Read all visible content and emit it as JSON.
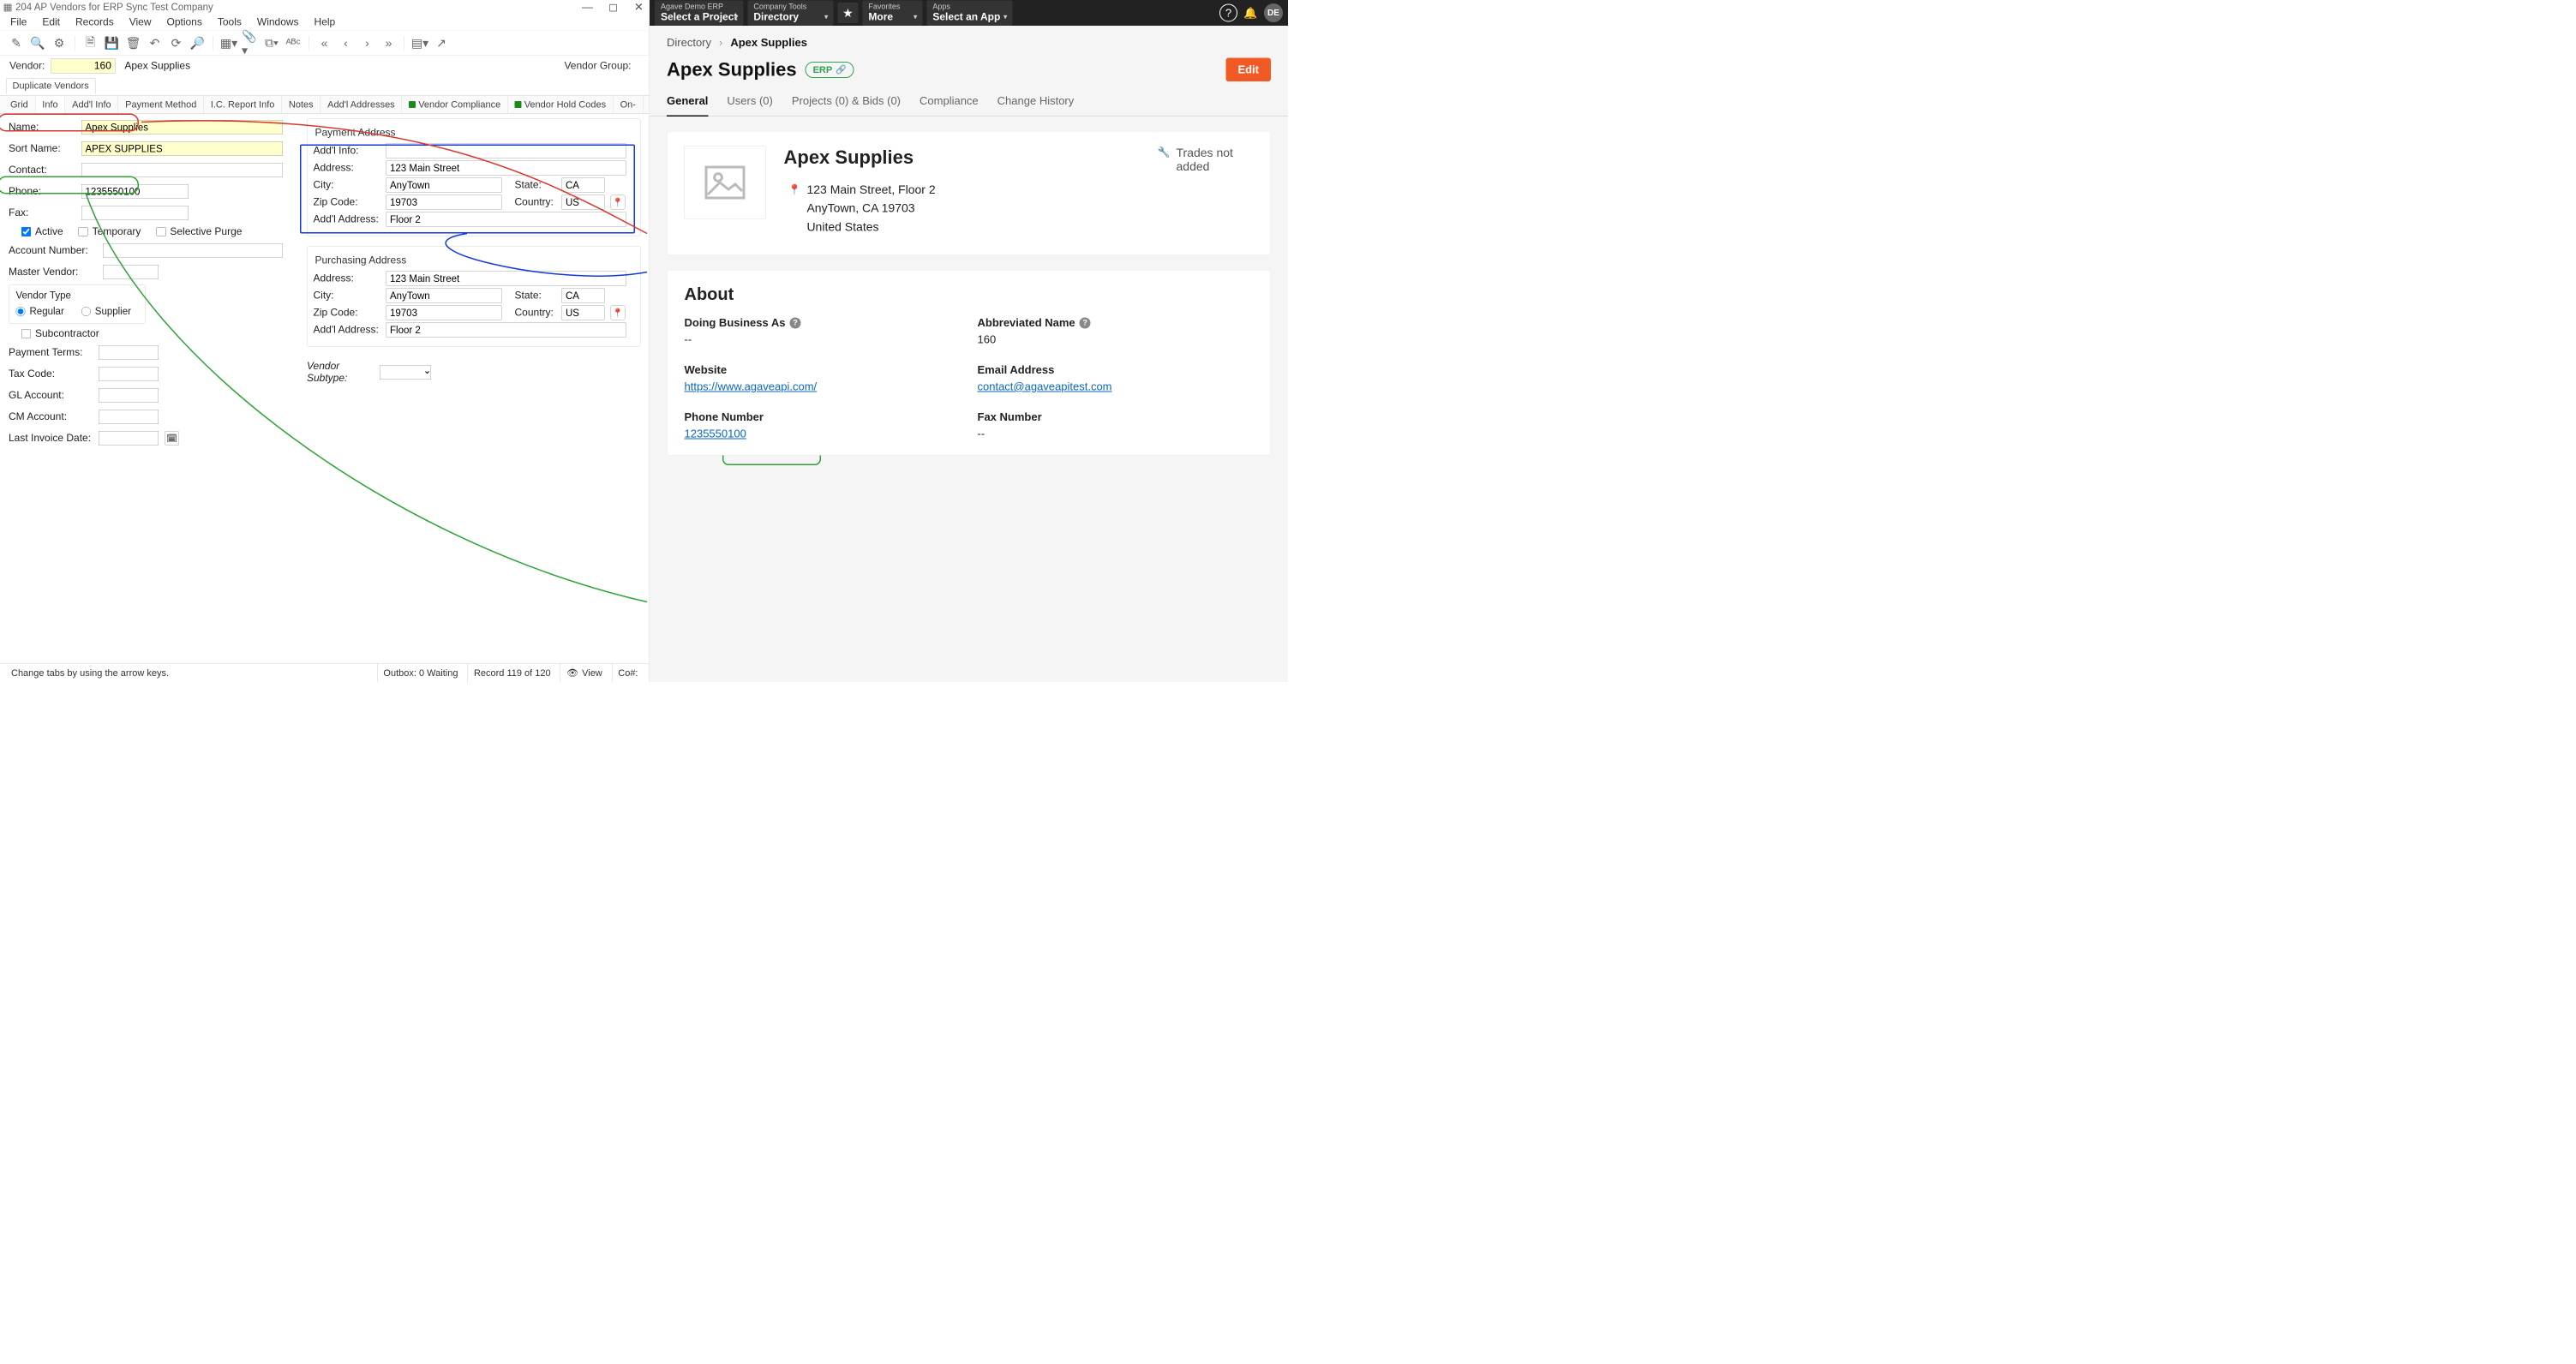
{
  "erp": {
    "window_title": "204 AP Vendors for ERP Sync Test Company",
    "menus": [
      "File",
      "Edit",
      "Records",
      "View",
      "Options",
      "Tools",
      "Windows",
      "Help"
    ],
    "vendor_lbl": "Vendor:",
    "vendor_num": "160",
    "vendor_name": "Apex Supplies",
    "vendor_group_lbl": "Vendor Group:",
    "dup_tab": "Duplicate Vendors",
    "subtabs": [
      "Grid",
      "Info",
      "Add'l Info",
      "Payment Method",
      "I.C. Report Info",
      "Notes",
      "Add'l Addresses",
      "Vendor Compliance",
      "Vendor Hold Codes",
      "On-"
    ],
    "active_subtab": "Info",
    "labels": {
      "name": "Name:",
      "sort_name": "Sort Name:",
      "contact": "Contact:",
      "phone": "Phone:",
      "fax": "Fax:",
      "active": "Active",
      "temporary": "Temporary",
      "selective_purge": "Selective Purge",
      "account_number": "Account Number:",
      "master_vendor": "Master Vendor:",
      "vendor_type": "Vendor Type",
      "regular": "Regular",
      "supplier": "Supplier",
      "subcontractor": "Subcontractor",
      "payment_terms": "Payment Terms:",
      "tax_code": "Tax Code:",
      "gl_account": "GL Account:",
      "cm_account": "CM Account:",
      "last_invoice": "Last Invoice Date:",
      "payment_address": "Payment Address",
      "addl_info": "Add'l Info:",
      "address": "Address:",
      "city": "City:",
      "state": "State:",
      "zip": "Zip Code:",
      "country": "Country:",
      "addl_address": "Add'l Address:",
      "purchasing_address": "Purchasing Address",
      "vendor_subtype": "Vendor Subtype:"
    },
    "values": {
      "name": "Apex Supplies",
      "sort_name": "APEX SUPPLIES",
      "contact": "",
      "phone": "1235550100",
      "fax": "",
      "account_number": "",
      "master_vendor": "",
      "payment_terms": "",
      "tax_code": "",
      "gl_account": "",
      "cm_account": "",
      "last_invoice": "",
      "pay_addl_info": "",
      "pay_address": "123 Main Street",
      "pay_city": "AnyTown",
      "pay_state": "CA",
      "pay_zip": "19703",
      "pay_country": "US",
      "pay_addl_address": "Floor 2",
      "pur_address": "123 Main Street",
      "pur_city": "AnyTown",
      "pur_state": "CA",
      "pur_zip": "19703",
      "pur_country": "US",
      "pur_addl_address": "Floor 2"
    },
    "status": {
      "hint": "Change tabs by using the arrow keys.",
      "outbox": "Outbox: 0 Waiting",
      "record": "Record 119 of 120",
      "view": "View",
      "co": "Co#:"
    }
  },
  "web": {
    "top": {
      "m1_label": "Agave Demo ERP",
      "m1_val": "Select a Project",
      "m2_label": "Company Tools",
      "m2_val": "Directory",
      "m3_label": "Favorites",
      "m3_val": "More",
      "m4_label": "Apps",
      "m4_val": "Select an App",
      "avatar": "DE"
    },
    "crumbs": {
      "root": "Directory",
      "current": "Apex Supplies"
    },
    "title": "Apex Supplies",
    "erp_badge": "ERP",
    "edit": "Edit",
    "tabs": [
      "General",
      "Users (0)",
      "Projects (0) & Bids (0)",
      "Compliance",
      "Change History"
    ],
    "active_tab": "General",
    "company": {
      "name": "Apex Supplies",
      "addr_line1": "123 Main Street, Floor 2",
      "addr_line2": "AnyTown, CA 19703",
      "addr_line3": "United States",
      "trades": "Trades not added"
    },
    "about": {
      "heading": "About",
      "dba_lbl": "Doing Business As",
      "dba_val": "--",
      "abbr_lbl": "Abbreviated Name",
      "abbr_val": "160",
      "website_lbl": "Website",
      "website_val": "https://www.agaveapi.com/",
      "email_lbl": "Email Address",
      "email_val": "contact@agaveapitest.com",
      "phone_lbl": "Phone Number",
      "phone_val": "1235550100",
      "fax_lbl": "Fax Number",
      "fax_val": "--"
    }
  }
}
